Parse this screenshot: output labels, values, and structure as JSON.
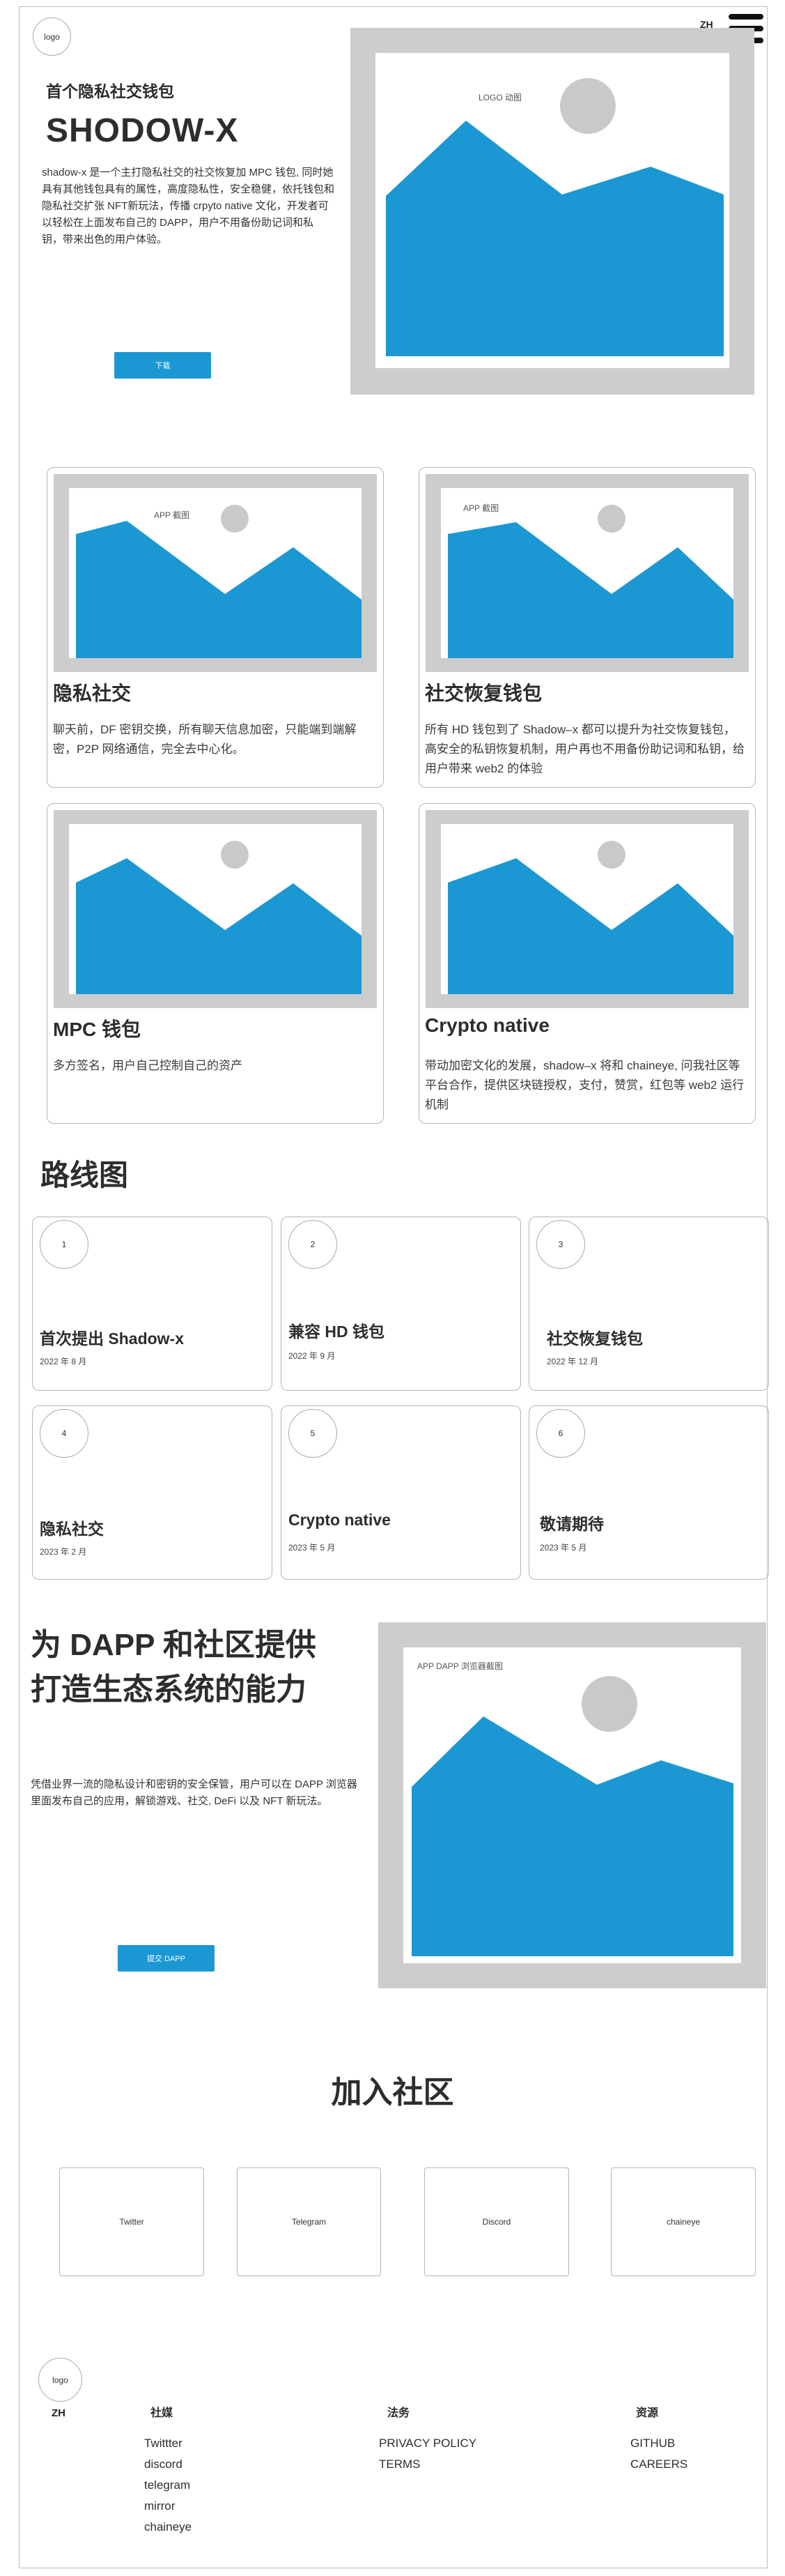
{
  "header": {
    "logo": "logo",
    "lang": "ZH"
  },
  "hero": {
    "subtitle": "首个隐私社交钱包",
    "title": "SHODOW-X",
    "desc": "shadow-x 是一个主打隐私社交的社交恢复加 MPC 钱包, 同时她具有其他钱包具有的属性，高度隐私性，安全稳健，依托钱包和隐私社交扩张 NFT新玩法，传播 crpyto native 文化，开发者可以轻松在上面发布自己的 DAPP，用户不用备份助记词和私钥，带来出色的用户体验。",
    "download_label": "下载",
    "image_caption": "LOGO 动图"
  },
  "features": [
    {
      "caption": "APP 截图",
      "title": "隐私社交",
      "desc": "聊天前，DF 密钥交换，所有聊天信息加密，只能端到端解密，P2P 网络通信，完全去中心化。"
    },
    {
      "caption": "APP 截图",
      "title": "社交恢复钱包",
      "desc": "所有 HD 钱包到了 Shadow–x 都可以提升为社交恢复钱包，高安全的私钥恢复机制，用户再也不用备份助记词和私钥，给用户带来 web2 的体验"
    },
    {
      "caption": "",
      "title": "MPC 钱包",
      "desc": "多方签名，用户自己控制自己的资产"
    },
    {
      "caption": "",
      "title": "Crypto native",
      "desc": "带动加密文化的发展，shadow–x 将和 chaineye, 问我社区等平台合作，提供区块链授权，支付，赞赏，红包等 web2 运行机制"
    }
  ],
  "roadmap": {
    "title": "路线图",
    "items": [
      {
        "num": "1",
        "title": "首次提出 Shadow-x",
        "date": "2022 年 8 月"
      },
      {
        "num": "2",
        "title": "兼容 HD 钱包",
        "date": "2022 年 9 月"
      },
      {
        "num": "3",
        "title": "社交恢复钱包",
        "date": "2022 年 12 月"
      },
      {
        "num": "4",
        "title": "隐私社交",
        "date": "2023 年 2 月"
      },
      {
        "num": "5",
        "title": "Crypto native",
        "date": "2023 年 5 月"
      },
      {
        "num": "6",
        "title": "敬请期待",
        "date": "2023 年 5 月"
      }
    ]
  },
  "dapp": {
    "title_line1": "为 DAPP 和社区提供",
    "title_line2": "打造生态系统的能力",
    "desc": "凭借业界一流的隐私设计和密钥的安全保管，用户可以在 DAPP 浏览器里面发布自己的应用，解锁游戏、社交, DeFi 以及 NFT 新玩法。",
    "button_label": "提交 DAPP",
    "image_caption": "APP DAPP 浏览器截图"
  },
  "community": {
    "title": "加入社区",
    "links": [
      "Twitter",
      "Telegram",
      "Discord",
      "chaineye"
    ]
  },
  "footer": {
    "logo": "logo",
    "lang": "ZH",
    "columns": [
      {
        "head": "社媒",
        "links": [
          "Twittter",
          "discord",
          "telegram",
          "mirror",
          "chaineye"
        ]
      },
      {
        "head": "法务",
        "links": [
          "PRIVACY POLICY",
          "TERMS"
        ]
      },
      {
        "head": "资源",
        "links": [
          "GITHUB",
          "CAREERS"
        ]
      }
    ]
  },
  "colors": {
    "accent": "#1b98d3",
    "placeholder_frame": "#cdcdcd",
    "sun": "#c9c9c9"
  }
}
